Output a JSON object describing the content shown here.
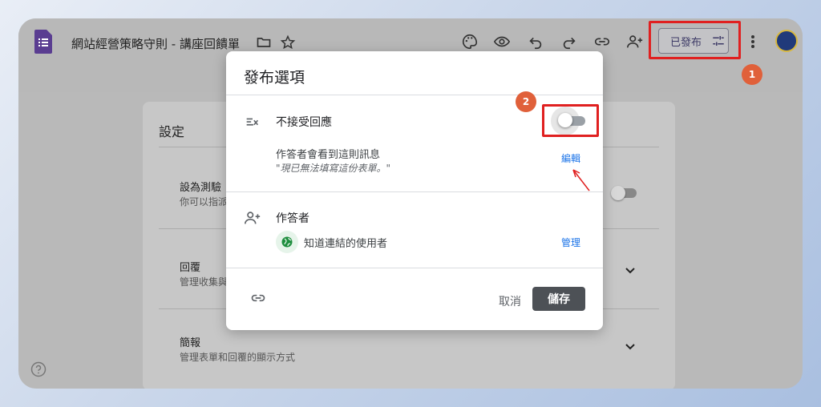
{
  "app": {
    "doc_title": "網站經營策略守則 - 講座回饋單",
    "publish_label": "已發布"
  },
  "toolbar_icons": [
    "palette-icon",
    "eye-icon",
    "undo-icon",
    "redo-icon",
    "link-icon",
    "add-person-icon"
  ],
  "annotations": {
    "badge1": "1",
    "badge2": "2",
    "highlight_color": "#e02020",
    "badge_color": "#e0603a"
  },
  "settings": {
    "title": "設定",
    "items": [
      {
        "title": "設為測驗",
        "sub": "你可以指派"
      },
      {
        "title": "回覆",
        "sub": "管理收集與"
      },
      {
        "title": "簡報",
        "sub": "管理表單和回覆的顯示方式"
      }
    ]
  },
  "dialog": {
    "title": "發布選項",
    "accept_label": "不接受回應",
    "accept_toggle_on": false,
    "message_label": "作答者會看到這則訊息",
    "message_text": "\"現已無法填寫這份表單。\"",
    "edit_link": "編輯",
    "respondents_label": "作答者",
    "audience_label": "知道連結的使用者",
    "manage_link": "管理",
    "cancel_label": "取消",
    "save_label": "儲存"
  }
}
